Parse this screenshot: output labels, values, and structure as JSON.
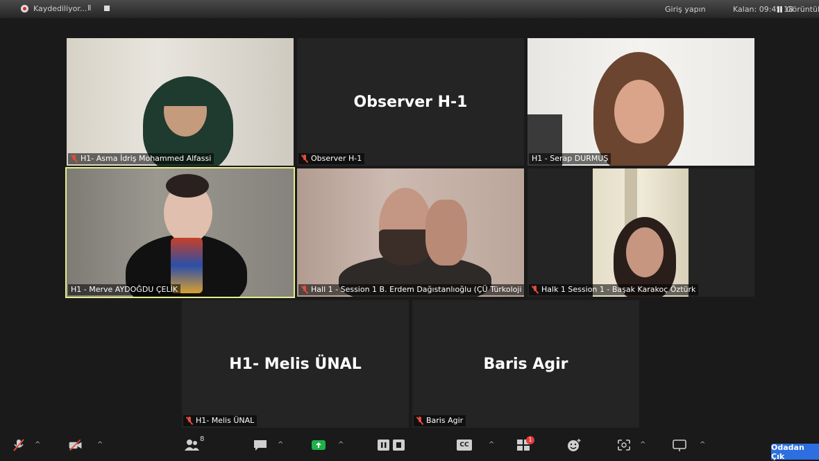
{
  "topbar": {
    "recording_label": "Kaydediliyor...",
    "pause_glyph": "II",
    "signin_label": "Giriş yapın",
    "remaining_label": "Kalan: 09:45:18",
    "view_label": "Görüntüle"
  },
  "tiles": [
    {
      "name": "H1- Asma İdriş Mohammed Alfassi",
      "muted": true
    },
    {
      "name": "Observer H-1",
      "center_text": "Observer H-1",
      "muted": true
    },
    {
      "name": "H1 - Serap DURMUŞ",
      "muted": false
    },
    {
      "name": "H1 - Merve AYDOĞDU ÇELİK",
      "muted": false,
      "active_speaker": true
    },
    {
      "name": "Hall 1 - Session 1 B. Erdem Dağıstanlıoğlu (ÇÜ Türkoloji ...",
      "muted": true
    },
    {
      "name": "Halk 1 Session 1 - Başak Karakoç Öztürk",
      "muted": true
    },
    {
      "name": "H1- Melis ÜNAL",
      "center_text": "H1- Melis ÜNAL",
      "muted": true
    },
    {
      "name": "Baris Agir",
      "center_text": "Baris Agir",
      "muted": true
    }
  ],
  "toolbar": {
    "participants_count": "8",
    "chat_badge": "1",
    "cc_label": "CC",
    "leave_label": "Odadan Çık",
    "icons": [
      "microphone-muted-icon",
      "video-off-icon",
      "participants-icon",
      "chat-icon",
      "share-screen-icon",
      "record-pause-icon",
      "record-stop-icon",
      "closed-caption-icon",
      "breakout-rooms-icon",
      "reactions-icon",
      "apps-icon",
      "whiteboard-icon"
    ]
  },
  "colors": {
    "active_speaker_border": "#e6f08a",
    "mute_red": "#e24c3c",
    "share_green": "#1fb14a",
    "leave_blue": "#2d6fe0"
  }
}
